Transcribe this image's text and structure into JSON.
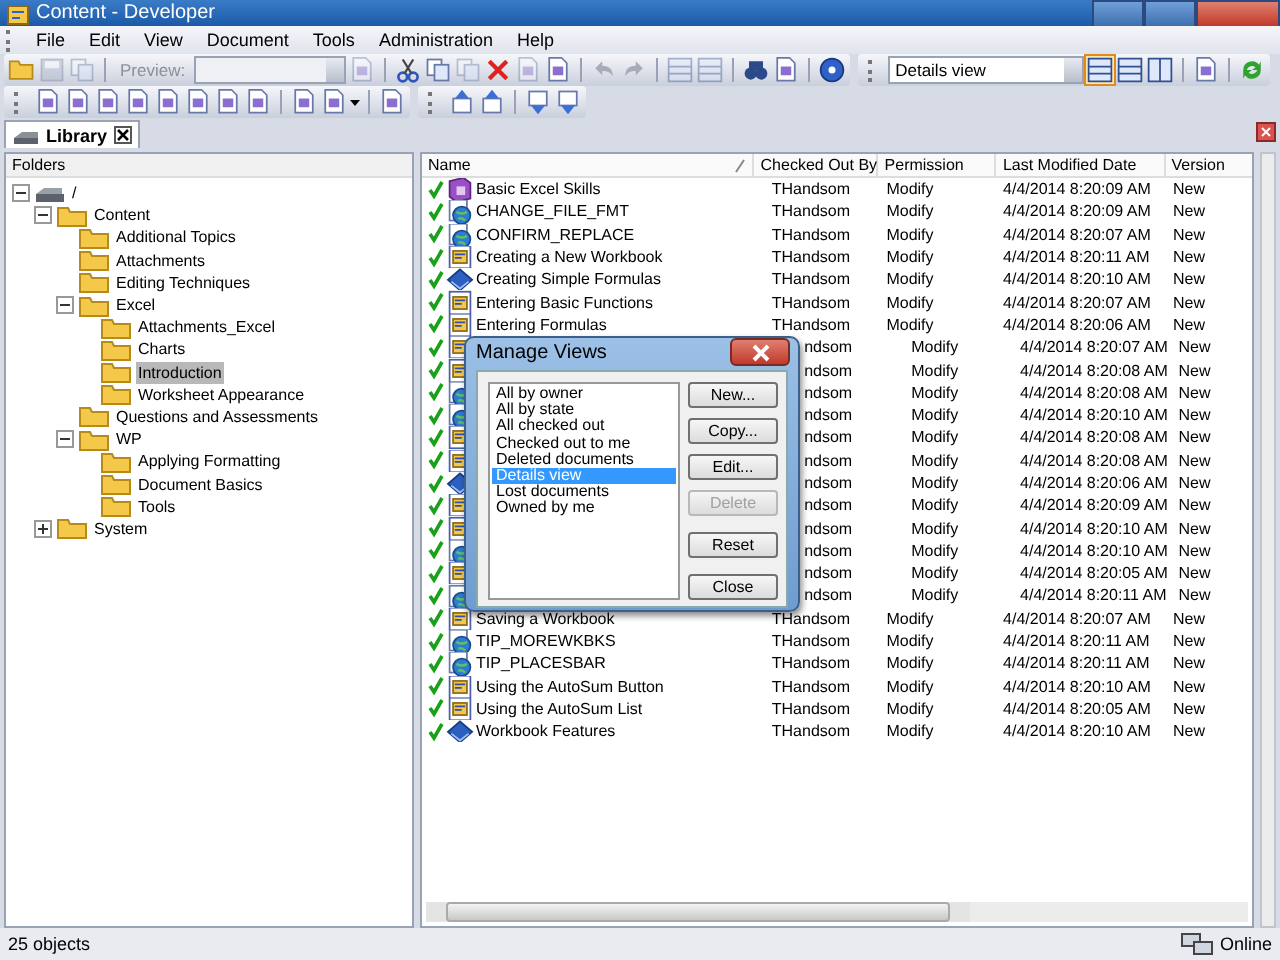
{
  "window": {
    "title": "Content - Developer"
  },
  "menu": [
    "File",
    "Edit",
    "View",
    "Document",
    "Tools",
    "Administration",
    "Help"
  ],
  "toolbar": {
    "preview_label": "Preview:",
    "preview_disabled": true,
    "view_select": "Details view"
  },
  "tabs": [
    {
      "label": "Library",
      "selected": true
    }
  ],
  "folders": {
    "header": "Folders",
    "tree": [
      {
        "label": "/",
        "kind": "drive",
        "expanded": true,
        "selected": false,
        "children": [
          {
            "label": "Content",
            "kind": "folder",
            "expanded": true,
            "selected": false,
            "children": [
              {
                "label": "Additional Topics",
                "kind": "folder",
                "selected": false
              },
              {
                "label": "Attachments",
                "kind": "folder",
                "selected": false
              },
              {
                "label": "Editing Techniques",
                "kind": "folder",
                "selected": false
              },
              {
                "label": "Excel",
                "kind": "folder",
                "expanded": true,
                "selected": false,
                "children": [
                  {
                    "label": "Attachments_Excel",
                    "kind": "folder",
                    "selected": false
                  },
                  {
                    "label": "Charts",
                    "kind": "folder",
                    "selected": false
                  },
                  {
                    "label": "Introduction",
                    "kind": "folder",
                    "selected": true
                  },
                  {
                    "label": "Worksheet Appearance",
                    "kind": "folder",
                    "selected": false
                  }
                ]
              },
              {
                "label": "Questions and Assessments",
                "kind": "folder",
                "selected": false
              },
              {
                "label": "WP",
                "kind": "folder",
                "expanded": true,
                "selected": false,
                "children": [
                  {
                    "label": "Applying Formatting",
                    "kind": "folder",
                    "selected": false
                  },
                  {
                    "label": "Document Basics",
                    "kind": "folder",
                    "selected": false
                  },
                  {
                    "label": "Tools",
                    "kind": "folder",
                    "selected": false
                  }
                ]
              }
            ]
          },
          {
            "label": "System",
            "kind": "folder",
            "expanded": false,
            "selected": false
          }
        ]
      }
    ]
  },
  "table": {
    "columns": [
      "Name",
      "Checked Out By",
      "Permission",
      "Last Modified Date",
      "Version"
    ],
    "rows": [
      {
        "kind": "book",
        "name": "Basic Excel Skills",
        "checked_out_by": "THandsom",
        "permission": "Modify",
        "modified": "4/4/2014 8:20:09 AM",
        "version": "New"
      },
      {
        "kind": "globe",
        "name": "CHANGE_FILE_FMT",
        "checked_out_by": "THandsom",
        "permission": "Modify",
        "modified": "4/4/2014 8:20:09 AM",
        "version": "New"
      },
      {
        "kind": "globe",
        "name": "CONFIRM_REPLACE",
        "checked_out_by": "THandsom",
        "permission": "Modify",
        "modified": "4/4/2014 8:20:07 AM",
        "version": "New"
      },
      {
        "kind": "topic",
        "name": "Creating a New Workbook",
        "checked_out_by": "THandsom",
        "permission": "Modify",
        "modified": "4/4/2014 8:20:11 AM",
        "version": "New"
      },
      {
        "kind": "module",
        "name": "Creating Simple Formulas",
        "checked_out_by": "THandsom",
        "permission": "Modify",
        "modified": "4/4/2014 8:20:10 AM",
        "version": "New"
      },
      {
        "kind": "topic",
        "name": "Entering Basic Functions",
        "checked_out_by": "THandsom",
        "permission": "Modify",
        "modified": "4/4/2014 8:20:07 AM",
        "version": "New"
      },
      {
        "kind": "topic",
        "name": "Entering Formulas",
        "checked_out_by": "THandsom",
        "permission": "Modify",
        "modified": "4/4/2014 8:20:06 AM",
        "version": "New"
      },
      {
        "kind": "topic",
        "checked_out_by": "ndsom",
        "permission": "Modify",
        "modified": "4/4/2014 8:20:07 AM",
        "version": "New"
      },
      {
        "kind": "topic",
        "checked_out_by": "ndsom",
        "permission": "Modify",
        "modified": "4/4/2014 8:20:08 AM",
        "version": "New"
      },
      {
        "kind": "globe",
        "checked_out_by": "ndsom",
        "permission": "Modify",
        "modified": "4/4/2014 8:20:08 AM",
        "version": "New"
      },
      {
        "kind": "globe",
        "checked_out_by": "ndsom",
        "permission": "Modify",
        "modified": "4/4/2014 8:20:10 AM",
        "version": "New"
      },
      {
        "kind": "topic",
        "checked_out_by": "ndsom",
        "permission": "Modify",
        "modified": "4/4/2014 8:20:08 AM",
        "version": "New"
      },
      {
        "kind": "topic",
        "checked_out_by": "ndsom",
        "permission": "Modify",
        "modified": "4/4/2014 8:20:08 AM",
        "version": "New"
      },
      {
        "kind": "module",
        "checked_out_by": "ndsom",
        "permission": "Modify",
        "modified": "4/4/2014 8:20:06 AM",
        "version": "New"
      },
      {
        "kind": "topic",
        "checked_out_by": "ndsom",
        "permission": "Modify",
        "modified": "4/4/2014 8:20:09 AM",
        "version": "New"
      },
      {
        "kind": "topic",
        "checked_out_by": "ndsom",
        "permission": "Modify",
        "modified": "4/4/2014 8:20:10 AM",
        "version": "New"
      },
      {
        "kind": "globe",
        "checked_out_by": "ndsom",
        "permission": "Modify",
        "modified": "4/4/2014 8:20:10 AM",
        "version": "New"
      },
      {
        "kind": "topic",
        "checked_out_by": "ndsom",
        "permission": "Modify",
        "modified": "4/4/2014 8:20:05 AM",
        "version": "New"
      },
      {
        "kind": "globe",
        "checked_out_by": "ndsom",
        "permission": "Modify",
        "modified": "4/4/2014 8:20:11 AM",
        "version": "New"
      },
      {
        "kind": "topic",
        "name": "Saving a Workbook",
        "checked_out_by": "THandsom",
        "permission": "Modify",
        "modified": "4/4/2014 8:20:07 AM",
        "version": "New"
      },
      {
        "kind": "globe",
        "name": "TIP_MOREWKBKS",
        "checked_out_by": "THandsom",
        "permission": "Modify",
        "modified": "4/4/2014 8:20:11 AM",
        "version": "New"
      },
      {
        "kind": "globe",
        "name": "TIP_PLACESBAR",
        "checked_out_by": "THandsom",
        "permission": "Modify",
        "modified": "4/4/2014 8:20:11 AM",
        "version": "New"
      },
      {
        "kind": "topic",
        "name": "Using the AutoSum Button",
        "checked_out_by": "THandsom",
        "permission": "Modify",
        "modified": "4/4/2014 8:20:10 AM",
        "version": "New"
      },
      {
        "kind": "topic",
        "name": "Using the AutoSum List",
        "checked_out_by": "THandsom",
        "permission": "Modify",
        "modified": "4/4/2014 8:20:05 AM",
        "version": "New"
      },
      {
        "kind": "module",
        "name": "Workbook Features",
        "checked_out_by": "THandsom",
        "permission": "Modify",
        "modified": "4/4/2014 8:20:10 AM",
        "version": "New"
      }
    ]
  },
  "dialog": {
    "title": "Manage Views",
    "views": [
      {
        "label": "All by owner",
        "selected": false
      },
      {
        "label": "All by state",
        "selected": false
      },
      {
        "label": "All checked out",
        "selected": false
      },
      {
        "label": "Checked out to me",
        "selected": false
      },
      {
        "label": "Deleted documents",
        "selected": false
      },
      {
        "label": "Details view",
        "selected": true
      },
      {
        "label": "Lost documents",
        "selected": false
      },
      {
        "label": "Owned by me",
        "selected": false
      }
    ],
    "buttons": [
      {
        "label": "New...",
        "disabled": false
      },
      {
        "label": "Copy...",
        "disabled": false
      },
      {
        "label": "Edit...",
        "disabled": false
      },
      {
        "label": "Delete",
        "disabled": true
      },
      {
        "label": "Reset",
        "disabled": false
      },
      {
        "label": "Close",
        "disabled": false
      }
    ]
  },
  "status_bar": {
    "count": "25 objects",
    "connection": "Online"
  }
}
